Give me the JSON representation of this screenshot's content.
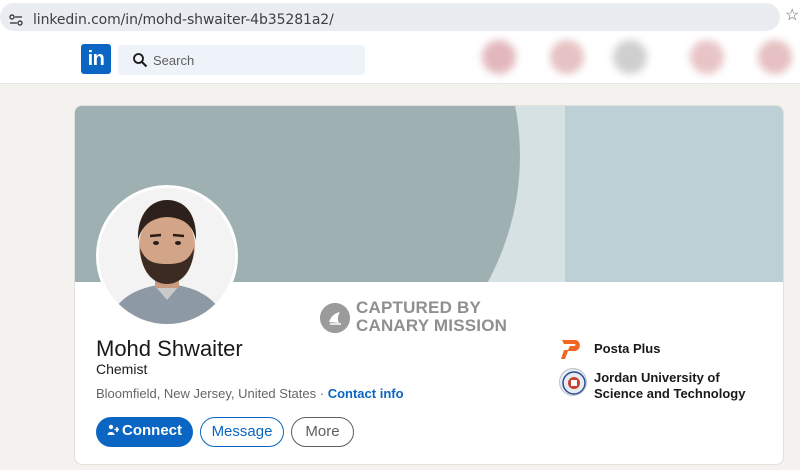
{
  "browser": {
    "url": "linkedin.com/in/mohd-shwaiter-4b35281a2/",
    "site_icon": "site-settings-icon",
    "bookmark_icon": "star-icon"
  },
  "navbar": {
    "logo_text": "in",
    "search_placeholder": "Search"
  },
  "profile": {
    "name": "Mohd Shwaiter",
    "headline": "Chemist",
    "location": "Bloomfield, New Jersey, United States",
    "separator": " · ",
    "contact_label": "Contact info",
    "buttons": {
      "connect": "Connect",
      "message": "Message",
      "more": "More"
    },
    "experience": [
      {
        "name": "Posta Plus"
      },
      {
        "name": "Jordan University of Science and Technology"
      }
    ]
  },
  "watermark": {
    "line1": "CAPTURED BY",
    "line2": "CANARY MISSION"
  },
  "colors": {
    "linkedin_blue": "#0a66c2",
    "posta_orange": "#f26522",
    "banner_gray": "#9fb0b3"
  }
}
